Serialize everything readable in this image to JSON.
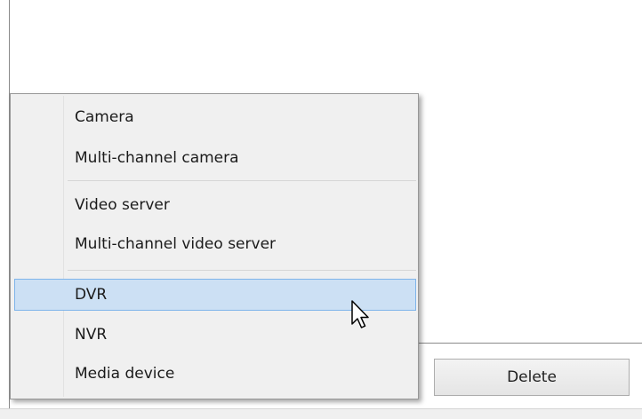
{
  "window": {
    "delete_label": "Delete"
  },
  "context_menu": {
    "items": [
      {
        "label": "Camera"
      },
      {
        "label": "Multi-channel camera"
      },
      {
        "label": "Video server"
      },
      {
        "label": "Multi-channel video server"
      },
      {
        "label": "DVR",
        "highlighted": true
      },
      {
        "label": "NVR"
      },
      {
        "label": "Media device"
      }
    ]
  },
  "colors": {
    "highlight_fill": "#cce0f4",
    "highlight_border": "#7eb4ea",
    "menu_background": "#f0f0f0"
  },
  "icons": {
    "cursor": "arrow-cursor-icon"
  }
}
